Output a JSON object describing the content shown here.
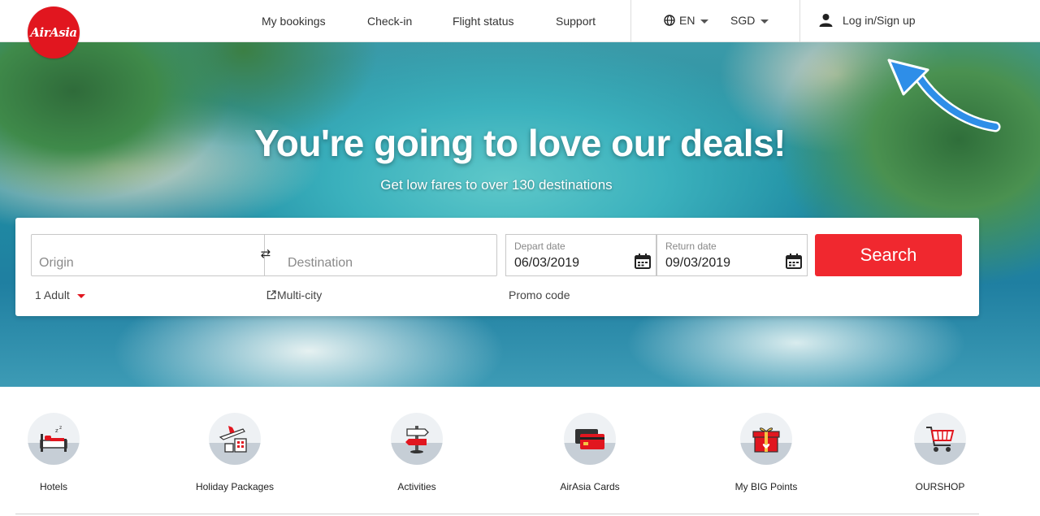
{
  "brand": {
    "logo_text": "AirAsia",
    "color": "#e1161f"
  },
  "nav": {
    "my_bookings": "My bookings",
    "check_in": "Check-in",
    "flight_status": "Flight status",
    "support": "Support",
    "language": "EN",
    "currency": "SGD",
    "login": "Log in/Sign up"
  },
  "hero": {
    "title": "You're going to love our deals!",
    "subtitle": "Get low fares to over 130 destinations"
  },
  "search": {
    "origin_placeholder": "Origin",
    "destination_placeholder": "Destination",
    "depart_label": "Depart date",
    "depart_value": "06/03/2019",
    "return_label": "Return date",
    "return_value": "09/03/2019",
    "search_button": "Search",
    "passengers": "1 Adult",
    "multi_city": "Multi-city",
    "promo_code": "Promo code",
    "accent": "#f0282f"
  },
  "categories": [
    {
      "label": "Hotels",
      "icon": "hotel-bed-icon"
    },
    {
      "label": "Holiday Packages",
      "icon": "plane-buildings-icon"
    },
    {
      "label": "Activities",
      "icon": "signpost-icon"
    },
    {
      "label": "AirAsia Cards",
      "icon": "credit-cards-icon"
    },
    {
      "label": "My BIG Points",
      "icon": "gift-box-icon"
    },
    {
      "label": "OURSHOP",
      "icon": "shopping-cart-icon"
    }
  ]
}
